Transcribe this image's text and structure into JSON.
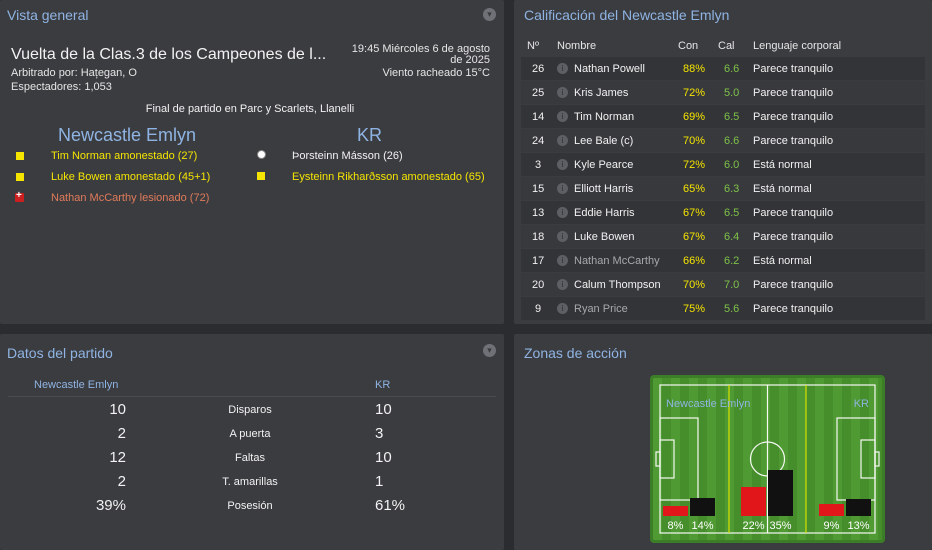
{
  "overview": {
    "title": "Vista general",
    "competition": "Vuelta de la Clas.3 de los Campeones de l...",
    "referee": "Arbitrado por: Hațegan, O",
    "spectators": "Espectadores: 1,053",
    "datetime_line1": "19:45 Miércoles 6 de agosto",
    "datetime_line2": "de 2025",
    "weather": "Viento racheado 15°C",
    "venue": "Final de partido en Parc y Scarlets, Llanelli",
    "home_team": "Newcastle Emlyn",
    "away_team": "KR",
    "home_events": [
      {
        "type": "yellow-card",
        "text": "Tim Norman amonestado (27)"
      },
      {
        "type": "yellow-card",
        "text": "Luke Bowen amonestado (45+1)"
      },
      {
        "type": "injury",
        "text": "Nathan McCarthy lesionado (72)"
      }
    ],
    "away_events": [
      {
        "type": "goal",
        "text": "Þorsteinn Másson (26)"
      },
      {
        "type": "yellow-card",
        "text": "Eysteinn Rikharðsson amonestado (65)"
      }
    ],
    "colors": {
      "event_yellow": "#f5e500",
      "event_injury": "#e07b5a"
    }
  },
  "ratings": {
    "title": "Calificación del Newcastle Emlyn",
    "headers": {
      "num": "Nº",
      "name": "Nombre",
      "con": "Con",
      "cal": "Cal",
      "body": "Lenguaje corporal"
    },
    "rows": [
      {
        "num": "26",
        "name": "Nathan Powell",
        "con": "88%",
        "cal": "6.6",
        "body": "Parece tranquilo",
        "dim": false
      },
      {
        "num": "25",
        "name": "Kris James",
        "con": "72%",
        "cal": "5.0",
        "body": "Parece tranquilo",
        "dim": false
      },
      {
        "num": "14",
        "name": "Tim Norman",
        "con": "69%",
        "cal": "6.5",
        "body": "Parece tranquilo",
        "dim": false
      },
      {
        "num": "24",
        "name": "Lee Bale (c)",
        "con": "70%",
        "cal": "6.6",
        "body": "Parece tranquilo",
        "dim": false
      },
      {
        "num": "3",
        "name": "Kyle Pearce",
        "con": "72%",
        "cal": "6.0",
        "body": "Está normal",
        "dim": false
      },
      {
        "num": "15",
        "name": "Elliott Harris",
        "con": "65%",
        "cal": "6.3",
        "body": "Está normal",
        "dim": false
      },
      {
        "num": "13",
        "name": "Eddie Harris",
        "con": "67%",
        "cal": "6.5",
        "body": "Parece tranquilo",
        "dim": false
      },
      {
        "num": "18",
        "name": "Luke Bowen",
        "con": "67%",
        "cal": "6.4",
        "body": "Parece tranquilo",
        "dim": false
      },
      {
        "num": "17",
        "name": "Nathan McCarthy",
        "con": "66%",
        "cal": "6.2",
        "body": "Está normal",
        "dim": true
      },
      {
        "num": "20",
        "name": "Calum Thompson",
        "con": "70%",
        "cal": "7.0",
        "body": "Parece tranquilo",
        "dim": false
      },
      {
        "num": "9",
        "name": "Ryan Price",
        "con": "75%",
        "cal": "5.6",
        "body": "Parece tranquilo",
        "dim": true
      }
    ]
  },
  "match_data": {
    "title": "Datos del partido",
    "home_team": "Newcastle Emlyn",
    "away_team": "KR",
    "stats": [
      {
        "home": "10",
        "label": "Disparos",
        "away": "10"
      },
      {
        "home": "2",
        "label": "A puerta",
        "away": "3"
      },
      {
        "home": "12",
        "label": "Faltas",
        "away": "10"
      },
      {
        "home": "2",
        "label": "T. amarillas",
        "away": "1"
      },
      {
        "home": "39%",
        "label": "Posesión",
        "away": "61%"
      }
    ]
  },
  "action_zones": {
    "title": "Zonas de acción",
    "home_team": "Newcastle Emlyn",
    "away_team": "KR",
    "zones": [
      {
        "home_pct": 8,
        "home_label": "8%",
        "away_pct": 14,
        "away_label": "14%"
      },
      {
        "home_pct": 22,
        "home_label": "22%",
        "away_pct": 35,
        "away_label": "35%"
      },
      {
        "home_pct": 9,
        "home_label": "9%",
        "away_pct": 13,
        "away_label": "13%"
      }
    ],
    "colors": {
      "home_bar": "#e0161b",
      "away_bar": "#111111",
      "zone_line": "#d9e000"
    }
  }
}
